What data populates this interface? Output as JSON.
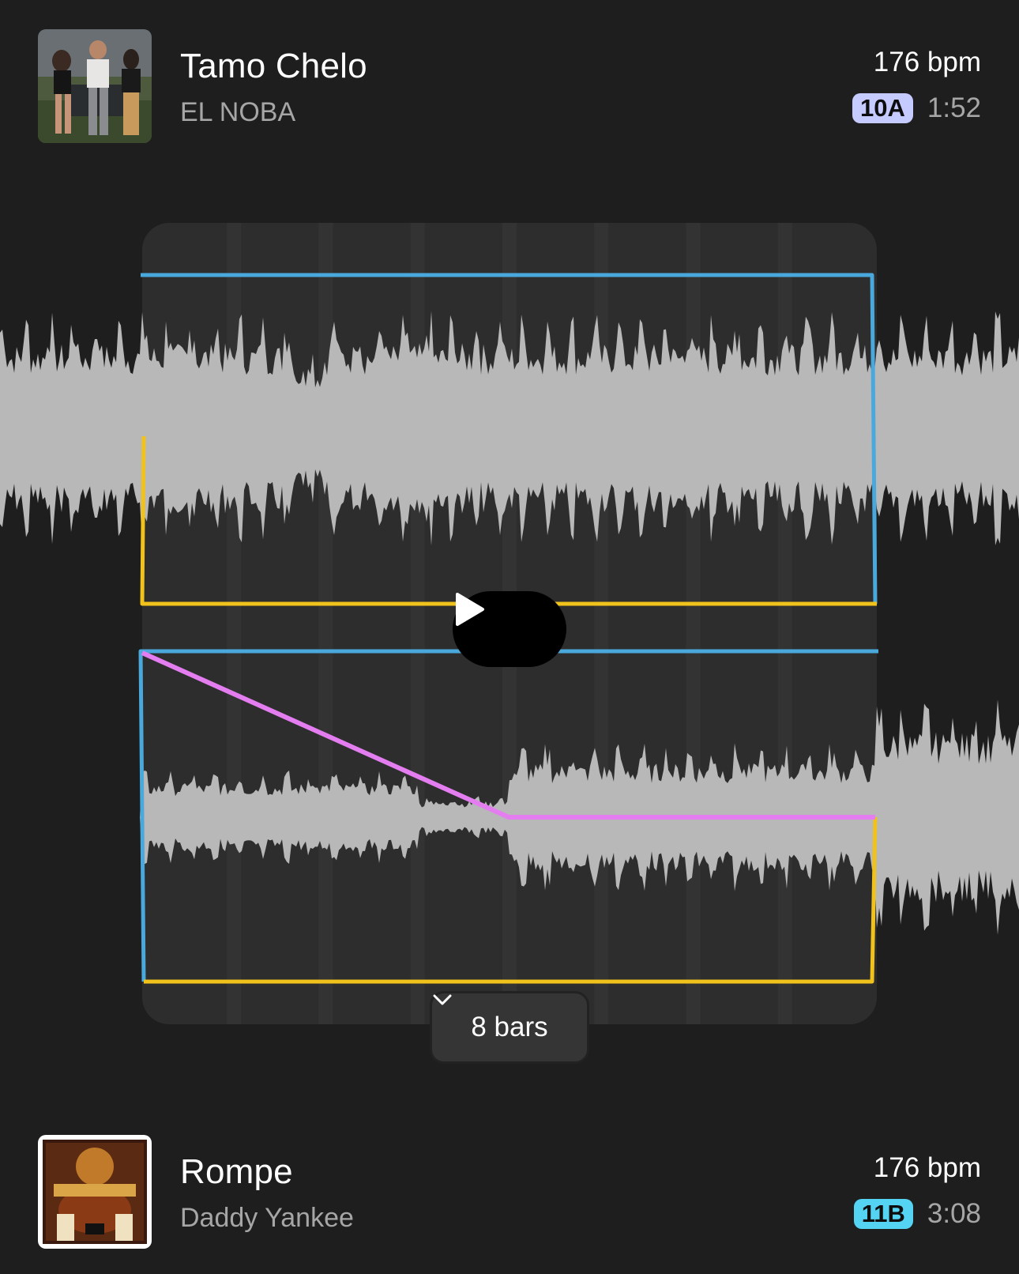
{
  "top_track": {
    "title": "Tamo Chelo",
    "artist": "EL NOBA",
    "bpm": "176 bpm",
    "key": "10A",
    "key_color": "#c5caff",
    "duration": "1:52",
    "cover_icon": "album-cover-image"
  },
  "bottom_track": {
    "title": "Rompe",
    "artist": "Daddy Yankee",
    "bpm": "176 bpm",
    "key": "11B",
    "key_color": "#55d3f2",
    "duration": "3:08",
    "cover_icon": "album-cover-image"
  },
  "transition": {
    "length_label": "8 bars",
    "play_icon": "play-icon",
    "dropdown_icon": "chevron-down-icon",
    "colors": {
      "volume_envelope": "#4aa9dc",
      "filter_envelope": "#f1c21b",
      "crossfade_curve": "#e47ef0",
      "waveform": "#b8b8b8",
      "panel": "#2d2d2d"
    }
  }
}
